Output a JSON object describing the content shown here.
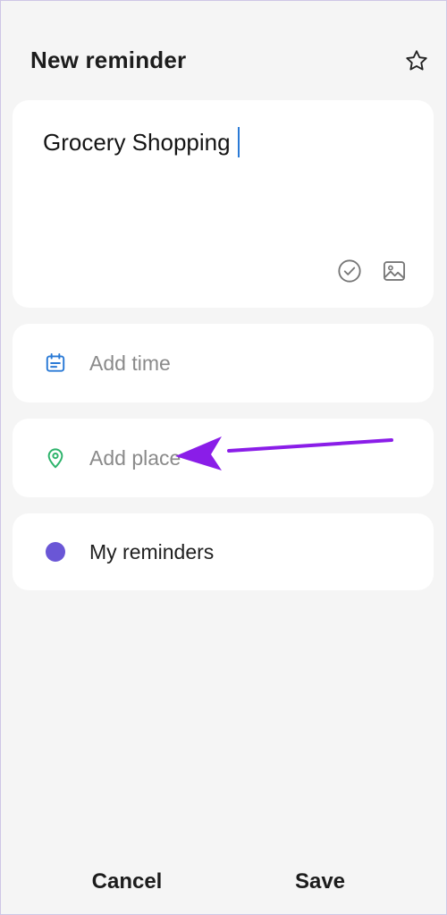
{
  "header": {
    "title": "New reminder",
    "favorite_icon": "star-outline-icon"
  },
  "reminder": {
    "title_value": "Grocery Shopping",
    "tools": {
      "checklist_icon": "check-circle-icon",
      "image_icon": "image-icon"
    }
  },
  "rows": {
    "time": {
      "label": "Add time",
      "icon": "calendar-icon",
      "color": "#2a7ad6"
    },
    "place": {
      "label": "Add place",
      "icon": "location-pin-icon",
      "color": "#2db36b"
    },
    "category": {
      "label": "My reminders",
      "color": "#6a56d6"
    }
  },
  "annotation": {
    "arrow_color": "#8a1de8"
  },
  "footer": {
    "cancel_label": "Cancel",
    "save_label": "Save"
  }
}
